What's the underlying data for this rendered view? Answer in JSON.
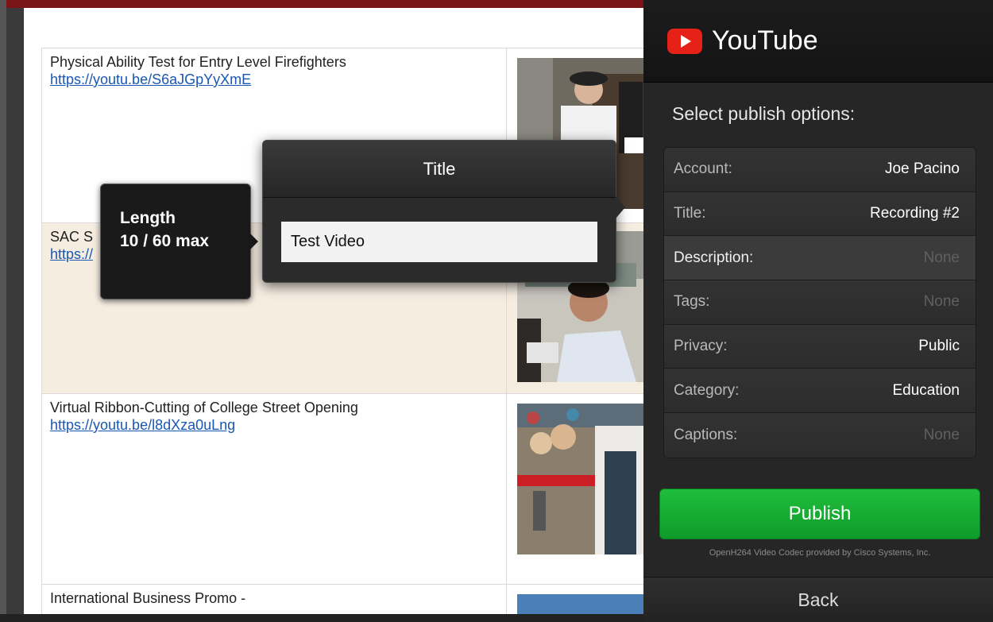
{
  "document": {
    "rows": [
      {
        "title": "Physical Ability Test for Entry Level Firefighters",
        "link": "https://youtu.be/S6aJGpYyXmE"
      },
      {
        "title": "SAC S",
        "link": "https://"
      },
      {
        "title": "Virtual Ribbon-Cutting of College Street Opening",
        "link": "https://youtu.be/l8dXza0uLng"
      },
      {
        "title": "International Business Promo -",
        "link": ""
      }
    ]
  },
  "length_tooltip": {
    "label": "Length",
    "count": "10 / 60 max"
  },
  "title_popover": {
    "header": "Title",
    "value": "Test Video"
  },
  "youtube": {
    "brand": "YouTube",
    "heading": "Select publish options:",
    "options": [
      {
        "key": "Account:",
        "value": "Joe Pacino",
        "none": false
      },
      {
        "key": "Title:",
        "value": "Recording #2",
        "none": false
      },
      {
        "key": "Description:",
        "value": "None",
        "none": true
      },
      {
        "key": "Tags:",
        "value": "None",
        "none": true
      },
      {
        "key": "Privacy:",
        "value": "Public",
        "none": false
      },
      {
        "key": "Category:",
        "value": "Education",
        "none": false
      },
      {
        "key": "Captions:",
        "value": "None",
        "none": true
      }
    ],
    "publish_label": "Publish",
    "codec_note": "OpenH264 Video Codec provided by Cisco Systems, Inc.",
    "back_label": "Back",
    "accent": "#e62117",
    "publish_color": "#1fbe3c"
  }
}
